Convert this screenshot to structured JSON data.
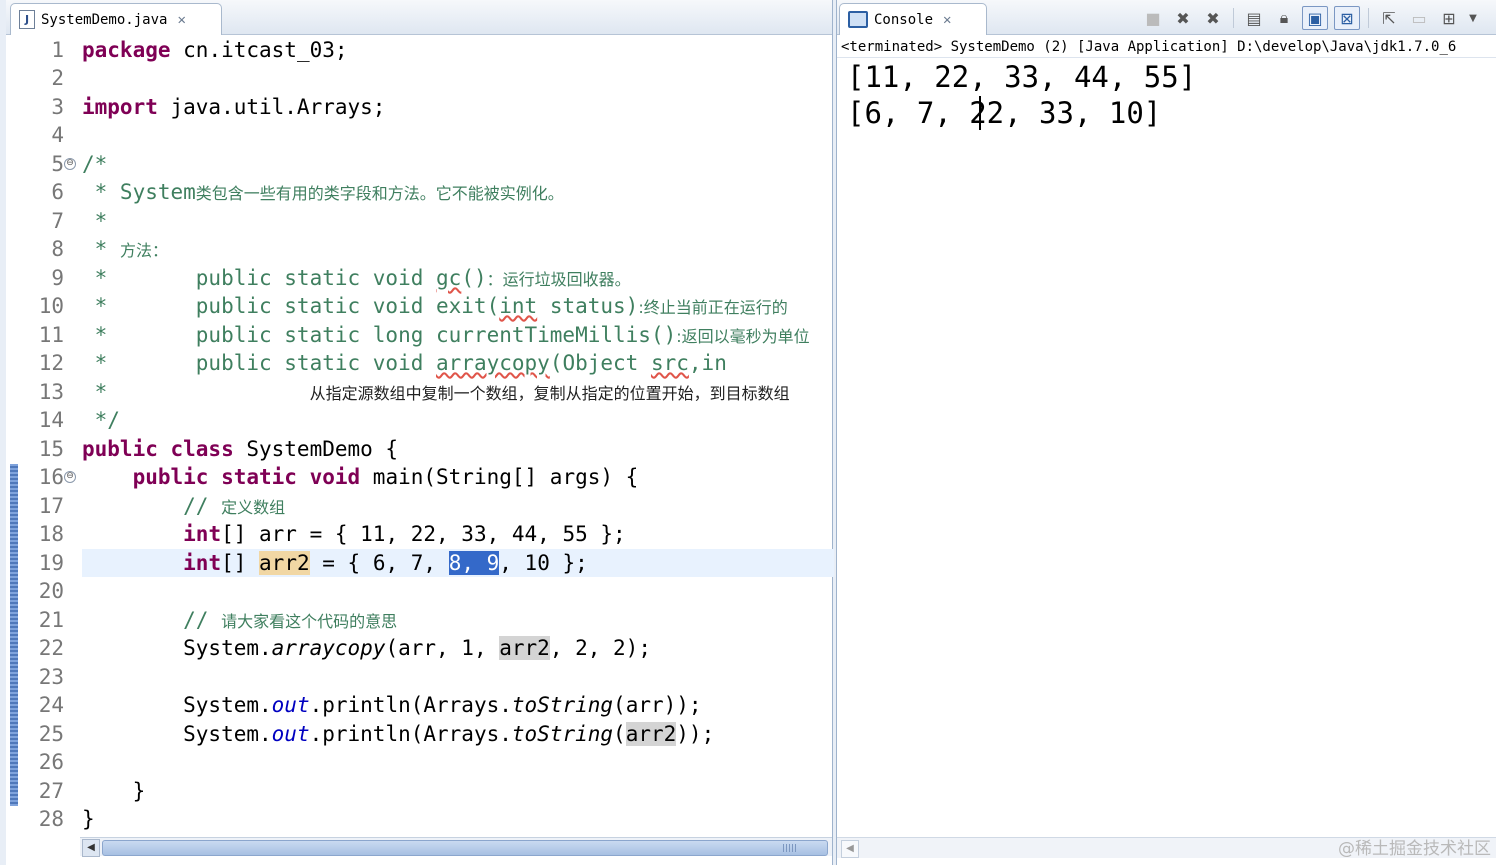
{
  "editor": {
    "tab_label": "SystemDemo.java",
    "tab_icon": "J",
    "line_numbers": [
      "1",
      "2",
      "3",
      "4",
      "5",
      "6",
      "7",
      "8",
      "9",
      "10",
      "11",
      "12",
      "13",
      "14",
      "15",
      "16",
      "17",
      "18",
      "19",
      "20",
      "21",
      "22",
      "23",
      "24",
      "25",
      "26",
      "27",
      "28"
    ],
    "code": {
      "l1_kw": "package",
      "l1_rest": " cn.itcast_03;",
      "l3_kw": "import",
      "l3_rest": " java.util.Arrays;",
      "l5": "/*",
      "l6_a": " * System",
      "l6_b": "类包含一些有用的类字段和方法。它不能被实例化。",
      "l7": " *",
      "l8_a": " * ",
      "l8_b": "方法：",
      "l9_a": " *       public static void ",
      "l9_b": "gc",
      "l9_c": "()",
      "l9_d": "：运行垃圾回收器。",
      "l10_a": " *       public static void exit(",
      "l10_b": "int",
      "l10_c": " status)",
      "l10_d": ":终止当前正在运行的",
      "l11_a": " *       public static long currentTimeMillis()",
      "l11_b": ":返回以毫秒为单位",
      "l12_a": " *       public static void ",
      "l12_b": "arraycopy",
      "l12_c": "(Object ",
      "l12_d": "src",
      "l12_e": ",in",
      "l13_a": " *                ",
      "l13_b": "从指定源数组中复制一个数组，复制从指定的位置开始，到目标数组",
      "l14": " */",
      "l15_kw": "public class",
      "l15_rest": " SystemDemo {",
      "l16_indent": "    ",
      "l16_kw": "public static void",
      "l16_rest": " main(String[] args) {",
      "l17_a": "        // ",
      "l17_b": "定义数组",
      "l18_indent": "        ",
      "l18_kw": "int",
      "l18_rest": "[] arr = { 11, 22, 33, 44, 55 };",
      "l19_indent": "        ",
      "l19_kw": "int",
      "l19_a": "[] ",
      "l19_var": "arr2",
      "l19_b": " = { 6, 7, ",
      "l19_sel": "8, 9",
      "l19_c": ", 10 };",
      "l21_a": "        // ",
      "l21_b": "请大家看这个代码的意思",
      "l22_a": "        System.",
      "l22_m": "arraycopy",
      "l22_b": "(arr, 1, ",
      "l22_var": "arr2",
      "l22_c": ", 2, 2);",
      "l24_a": "        System.",
      "l24_f": "out",
      "l24_b": ".println(Arrays.",
      "l24_m": "toString",
      "l24_c": "(arr));",
      "l25_a": "        System.",
      "l25_f": "out",
      "l25_b": ".println(Arrays.",
      "l25_m": "toString",
      "l25_c": "(",
      "l25_var": "arr2",
      "l25_d": "));",
      "l27": "    }",
      "l28": "}"
    }
  },
  "console": {
    "tab_label": "Console",
    "status": "<terminated> SystemDemo (2) [Java Application] D:\\develop\\Java\\jdk1.7.0_6",
    "output": [
      "[11, 22, 33, 44, 55]",
      "[6, 7, 22, 33, 10]"
    ],
    "toolbar_icons": [
      "terminate-icon",
      "remove-launch-icon",
      "remove-all-launches-icon",
      "clear-console-icon",
      "scroll-lock-icon",
      "word-wrap-icon",
      "pin-console-icon",
      "open-console-icon",
      "display-console-icon",
      "new-console-icon"
    ]
  },
  "watermark": "@稀土掘金技术社区",
  "colors": {
    "keyword": "#7f0055",
    "comment": "#3f7f5f",
    "field": "#0000c0",
    "selection": "#3469c9",
    "current_line": "#e8f2fe"
  }
}
